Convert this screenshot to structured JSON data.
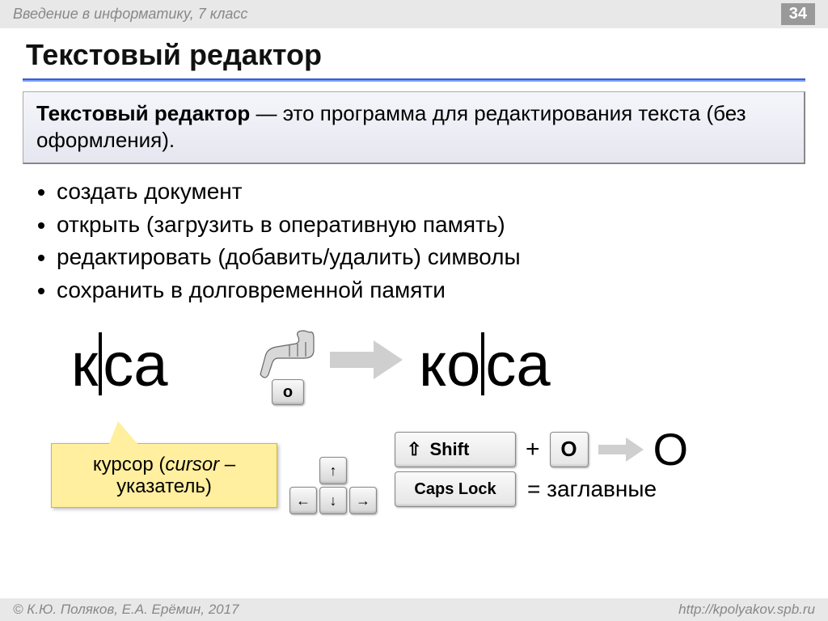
{
  "header": {
    "course_title": "Введение в информатику, 7 класс",
    "page_number": "34"
  },
  "slide": {
    "title": "Текстовый редактор",
    "definition_term": "Текстовый редактор",
    "definition_rest": " — это программа для редактирования текста (без оформления).",
    "bullets": [
      "создать документ",
      "открыть (загрузить в оперативную память)",
      "редактировать (добавить/удалить) символы",
      "сохранить в долговременной памяти"
    ],
    "demo": {
      "before_left": "к",
      "before_right": "са",
      "after_left": "ко",
      "after_right": "са",
      "key_pressed": "о",
      "callout_plain1": "курсор (",
      "callout_italic": "cursor",
      "callout_plain2": " – указатель)",
      "shift_label": "Shift",
      "plus": "+",
      "key_o_upper": "О",
      "result_upper": "О",
      "caps_label": "Caps Lock",
      "caps_result": "= заглавные"
    }
  },
  "footer": {
    "copyright": "© К.Ю. Поляков, Е.А. Ерёмин, 2017",
    "url": "http://kpolyakov.spb.ru"
  }
}
